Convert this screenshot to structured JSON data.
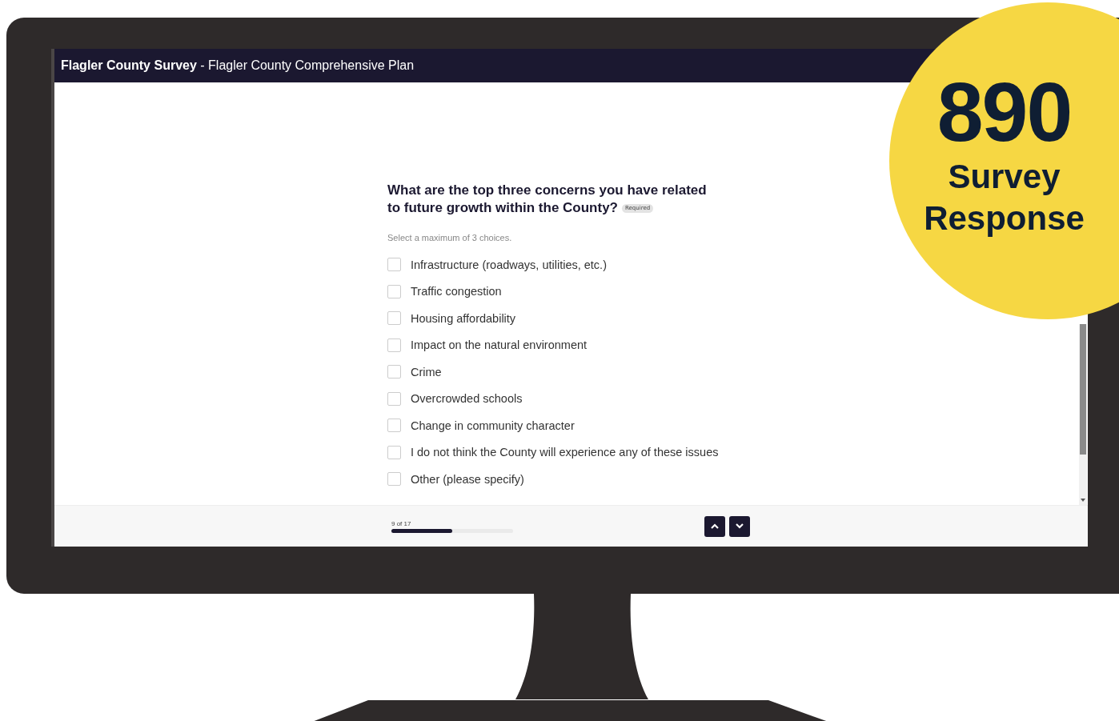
{
  "window": {
    "title": "**Flagler County Survey** - Flagler County Comprehensive Plan"
  },
  "question": {
    "text_lines": [
      "What are the top three concerns you have related",
      "to future growth within the County?"
    ],
    "required_badge": "Required",
    "hint": "Select a maximum of 3 choices.",
    "options": [
      {
        "label": "Infrastructure (roadways, utilities, etc.)",
        "checked": false
      },
      {
        "label": "Traffic congestion",
        "checked": false
      },
      {
        "label": "Housing affordability",
        "checked": false
      },
      {
        "label": "Impact on the natural environment",
        "checked": false
      },
      {
        "label": "Crime",
        "checked": false
      },
      {
        "label": "Overcrowded schools",
        "checked": false
      },
      {
        "label": "Change in community character",
        "checked": false
      },
      {
        "label": "I do not think the County will experience any of these issues",
        "checked": false
      },
      {
        "label": "Other (please specify)",
        "checked": false
      }
    ]
  },
  "footer": {
    "progress_label": "9 of 17",
    "level": 0.5
  },
  "badge": {
    "count": "890",
    "lines": [
      "Survey",
      "Response"
    ]
  }
}
